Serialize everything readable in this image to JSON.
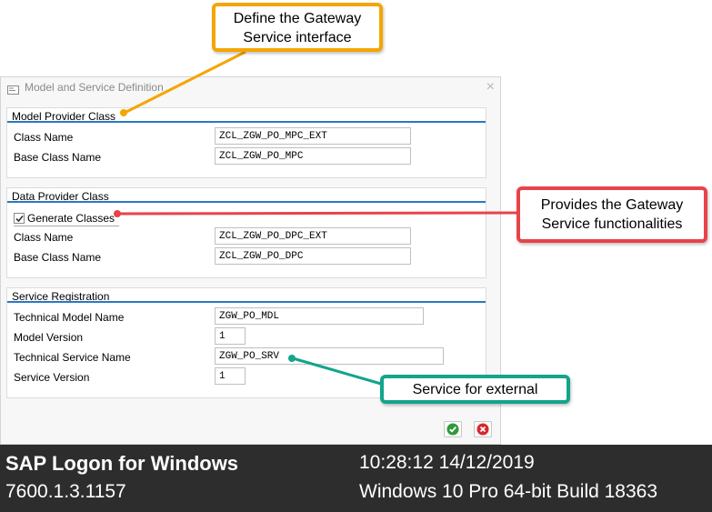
{
  "dialog": {
    "title": "Model and Service Definition",
    "close_glyph": "×",
    "model_provider": {
      "title": "Model Provider Class",
      "rows": [
        {
          "label": "Class Name",
          "value": "ZCL_ZGW_PO_MPC_EXT"
        },
        {
          "label": "Base Class Name",
          "value": "ZCL_ZGW_PO_MPC"
        }
      ]
    },
    "data_provider": {
      "title": "Data Provider Class",
      "generate_label": "Generate Classes",
      "generate_checked": true,
      "rows": [
        {
          "label": "Class Name",
          "value": "ZCL_ZGW_PO_DPC_EXT"
        },
        {
          "label": "Base Class Name",
          "value": "ZCL_ZGW_PO_DPC"
        }
      ]
    },
    "service_registration": {
      "title": "Service Registration",
      "rows": [
        {
          "label": "Technical Model Name",
          "value": "ZGW_PO_MDL"
        },
        {
          "label": "Model Version",
          "value": "1"
        },
        {
          "label": "Technical Service Name",
          "value": "ZGW_PO_SRV"
        },
        {
          "label": "Service Version",
          "value": "1"
        }
      ]
    },
    "icons": {
      "ok": "check-icon",
      "cancel": "cancel-icon"
    },
    "colors": {
      "accent_rule": "#2a78c2",
      "ok": "#2e9a3a",
      "cancel": "#d6282f"
    }
  },
  "callouts": {
    "orange": {
      "line1": "Define the Gateway",
      "line2": "Service interface",
      "color": "#f5a500"
    },
    "red": {
      "line1": "Provides the Gateway",
      "line2": "Service functionalities",
      "color": "#e8434a"
    },
    "green": {
      "text": "Service for external",
      "color": "#12a58a"
    }
  },
  "footer": {
    "app_name": "SAP Logon for Windows",
    "version": "7600.1.3.1157",
    "datetime": "10:28:12 14/12/2019",
    "os": "Windows 10 Pro 64-bit Build 18363"
  }
}
